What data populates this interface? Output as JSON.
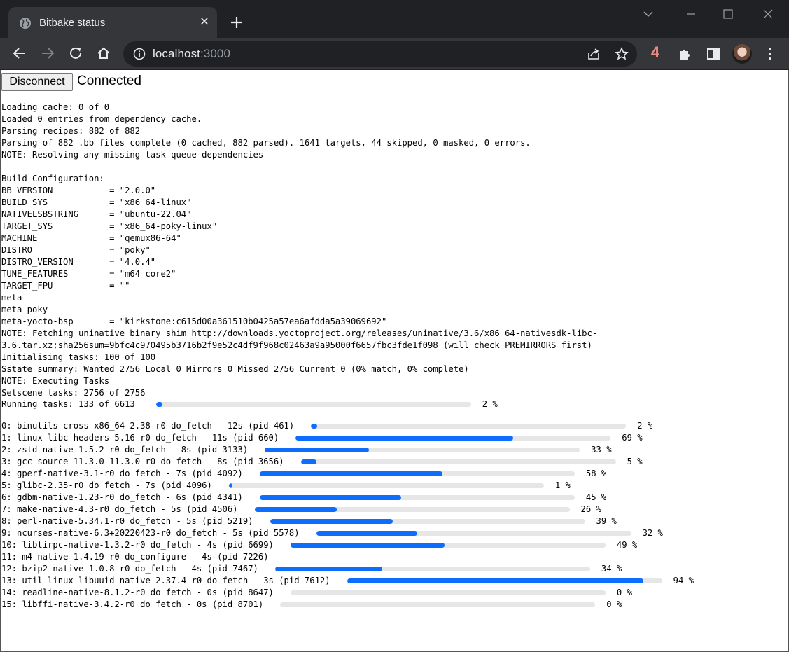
{
  "browser": {
    "tab_title": "Bitbake status",
    "url_host": "localhost",
    "url_port": ":3000",
    "extension_badge": "4",
    "colors": {
      "frame": "#202124",
      "toolbar": "#35363a",
      "badge": "#f28b82"
    }
  },
  "page": {
    "disconnect_label": "Disconnect",
    "connection_status": "Connected",
    "log_lines": [
      "Loading cache: 0 of 0",
      "Loaded 0 entries from dependency cache.",
      "Parsing recipes: 882 of 882",
      "Parsing of 882 .bb files complete (0 cached, 882 parsed). 1641 targets, 44 skipped, 0 masked, 0 errors.",
      "NOTE: Resolving any missing task queue dependencies",
      "",
      "Build Configuration:",
      "BB_VERSION           = \"2.0.0\"",
      "BUILD_SYS            = \"x86_64-linux\"",
      "NATIVELSBSTRING      = \"ubuntu-22.04\"",
      "TARGET_SYS           = \"x86_64-poky-linux\"",
      "MACHINE              = \"qemux86-64\"",
      "DISTRO               = \"poky\"",
      "DISTRO_VERSION       = \"4.0.4\"",
      "TUNE_FEATURES        = \"m64 core2\"",
      "TARGET_FPU           = \"\"",
      "meta",
      "meta-poky",
      "meta-yocto-bsp       = \"kirkstone:c615d00a361510b0425a57ea6afdda5a39069692\"",
      "NOTE: Fetching uninative binary shim http://downloads.yoctoproject.org/releases/uninative/3.6/x86_64-nativesdk-libc-",
      "3.6.tar.xz;sha256sum=9bfc4c970495b3716b2f9e52c4df9f968c02463a9a95000f6657fbc3fde1f098 (will check PREMIRRORS first)",
      "Initialising tasks: 100 of 100",
      "Sstate summary: Wanted 2756 Local 0 Mirrors 0 Missed 2756 Current 0 (0% match, 0% complete)",
      "NOTE: Executing Tasks",
      "Setscene tasks: 2756 of 2756"
    ],
    "running": {
      "label": "Running tasks: 133 of 6613",
      "progress": 2,
      "pct_text": "2 %"
    },
    "tasks": [
      {
        "label": "0: binutils-cross-x86_64-2.38-r0 do_fetch - 12s (pid 461)",
        "progress": 2,
        "pct_text": "2 %"
      },
      {
        "label": "1: linux-libc-headers-5.16-r0 do_fetch - 11s (pid 660)",
        "progress": 69,
        "pct_text": "69 %"
      },
      {
        "label": "2: zstd-native-1.5.2-r0 do_fetch - 8s (pid 3133)",
        "progress": 33,
        "pct_text": "33 %"
      },
      {
        "label": "3: gcc-source-11.3.0-11.3.0-r0 do_fetch - 8s (pid 3656)",
        "progress": 5,
        "pct_text": "5 %"
      },
      {
        "label": "4: gperf-native-3.1-r0 do_fetch - 7s (pid 4092)",
        "progress": 58,
        "pct_text": "58 %"
      },
      {
        "label": "5: glibc-2.35-r0 do_fetch - 7s (pid 4096)",
        "progress": 1,
        "pct_text": "1 %"
      },
      {
        "label": "6: gdbm-native-1.23-r0 do_fetch - 6s (pid 4341)",
        "progress": 45,
        "pct_text": "45 %"
      },
      {
        "label": "7: make-native-4.3-r0 do_fetch - 5s (pid 4506)",
        "progress": 26,
        "pct_text": "26 %"
      },
      {
        "label": "8: perl-native-5.34.1-r0 do_fetch - 5s (pid 5219)",
        "progress": 39,
        "pct_text": "39 %"
      },
      {
        "label": "9: ncurses-native-6.3+20220423-r0 do_fetch - 5s (pid 5578)",
        "progress": 32,
        "pct_text": "32 %"
      },
      {
        "label": "10: libtirpc-native-1.3.2-r0 do_fetch - 4s (pid 6699)",
        "progress": 49,
        "pct_text": "49 %"
      },
      {
        "label": "11: m4-native-1.4.19-r0 do_configure - 4s (pid 7226)",
        "progress": null,
        "pct_text": ""
      },
      {
        "label": "12: bzip2-native-1.0.8-r0 do_fetch - 4s (pid 7467)",
        "progress": 34,
        "pct_text": "34 %"
      },
      {
        "label": "13: util-linux-libuuid-native-2.37.4-r0 do_fetch - 3s (pid 7612)",
        "progress": 94,
        "pct_text": "94 %"
      },
      {
        "label": "14: readline-native-8.1.2-r0 do_fetch - 0s (pid 8647)",
        "progress": 0,
        "pct_text": "0 %"
      },
      {
        "label": "15: libffi-native-3.4.2-r0 do_fetch - 0s (pid 8701)",
        "progress": 0,
        "pct_text": "0 %"
      }
    ],
    "colors": {
      "bar_fill": "#0d6efd",
      "bar_track": "#e6e6e6"
    }
  }
}
